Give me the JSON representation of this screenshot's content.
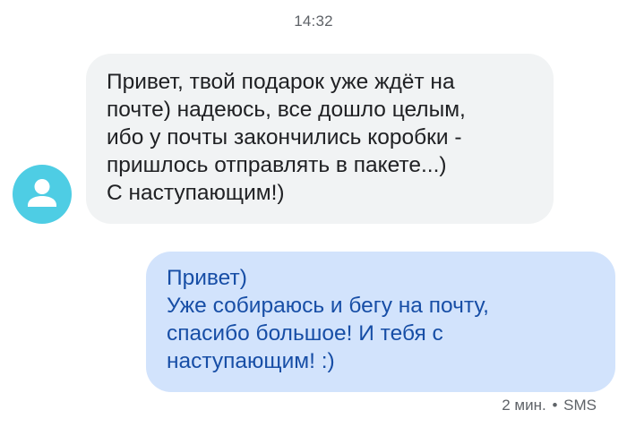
{
  "conversation": {
    "timestamp": "14:32",
    "messages": [
      {
        "direction": "incoming",
        "text": "Привет, твой подарок уже ждёт на\nпочте) надеюсь, все дошло целым,\nибо у почты закончились коробки -\nпришлось отправлять в пакете...)\nС наступающим!)"
      },
      {
        "direction": "outgoing",
        "text": "Привет)\nУже собираюсь и бегу на почту,\nспасибо большое! И тебя с\nнаступающим! :)"
      }
    ],
    "status": {
      "time_ago": "2 мин.",
      "separator": "•",
      "type": "SMS"
    }
  },
  "colors": {
    "avatar_bg": "#4ecde4",
    "incoming_bubble": "#f1f3f4",
    "outgoing_bubble": "#d2e3fc",
    "outgoing_text": "#174ea6"
  },
  "icons": {
    "avatar": "person-icon"
  }
}
